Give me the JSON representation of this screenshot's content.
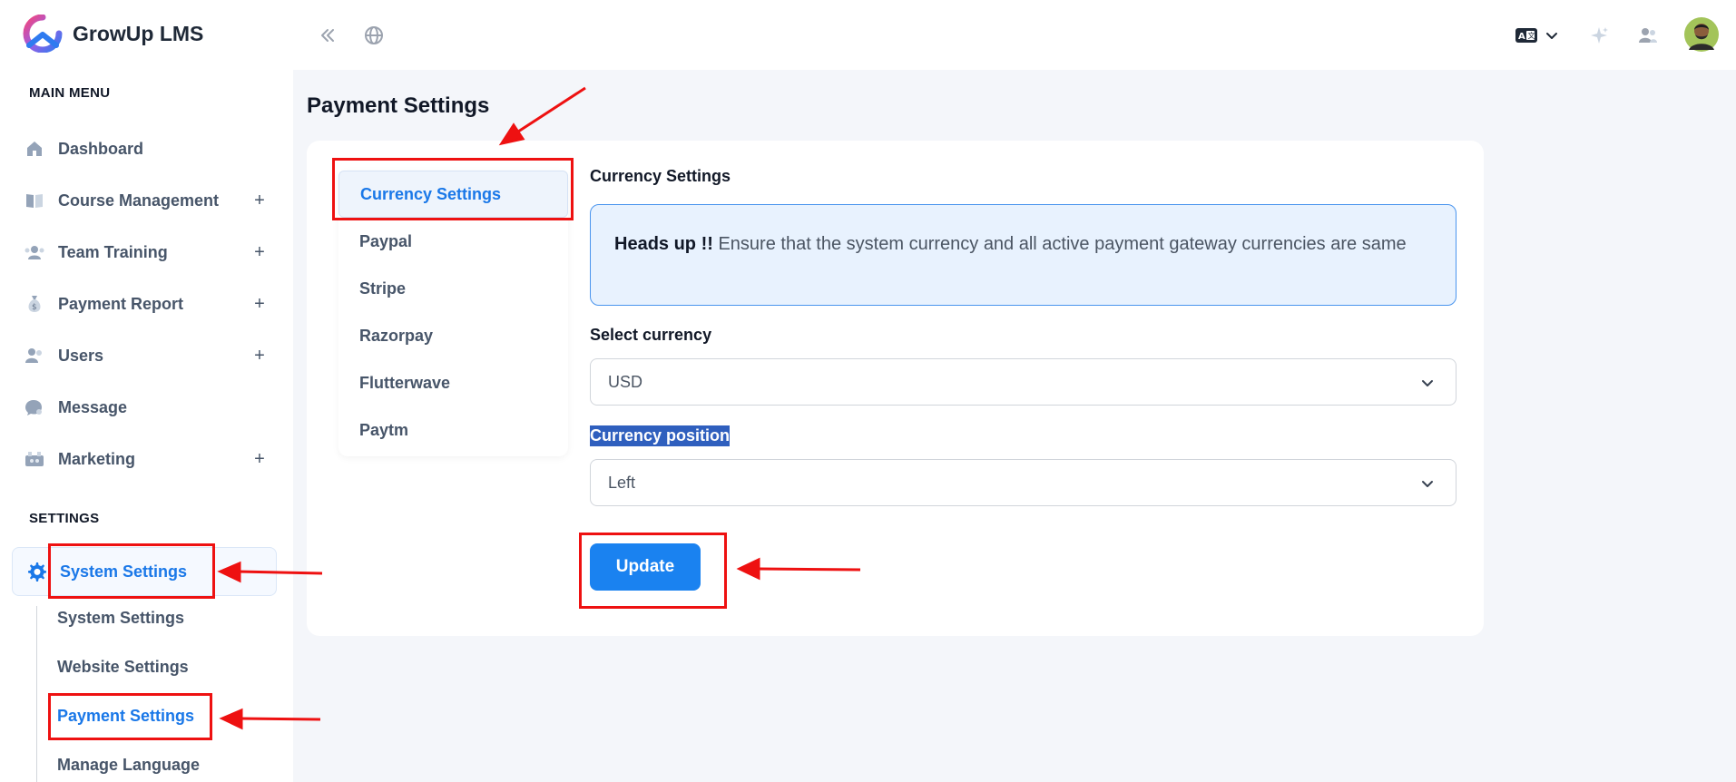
{
  "app": {
    "name": "GrowUp LMS"
  },
  "sidebar": {
    "main_menu_heading": "MAIN MENU",
    "items": [
      {
        "label": "Dashboard",
        "icon": "home-icon",
        "expandable": false
      },
      {
        "label": "Course Management",
        "icon": "book-icon",
        "expandable": true
      },
      {
        "label": "Team Training",
        "icon": "team-icon",
        "expandable": true
      },
      {
        "label": "Payment Report",
        "icon": "money-bag-icon",
        "expandable": true
      },
      {
        "label": "Users",
        "icon": "users-icon",
        "expandable": true
      },
      {
        "label": "Message",
        "icon": "chat-icon",
        "expandable": false
      },
      {
        "label": "Marketing",
        "icon": "megaphone-icon",
        "expandable": true
      }
    ],
    "settings_heading": "SETTINGS",
    "active_group": {
      "label": "System Settings",
      "icon": "gear-icon"
    },
    "sub_items": [
      {
        "label": "System Settings",
        "active": false
      },
      {
        "label": "Website Settings",
        "active": false
      },
      {
        "label": "Payment Settings",
        "active": true
      },
      {
        "label": "Manage Language",
        "active": false
      }
    ],
    "plus_symbol": "+"
  },
  "topbar": {
    "icons": [
      "collapse-icon",
      "globe-icon",
      "language-icon",
      "chevron-down-icon",
      "sparkle-icon",
      "users-icon",
      "avatar"
    ]
  },
  "page": {
    "title": "Payment Settings",
    "tabs": [
      "Currency Settings",
      "Paypal",
      "Stripe",
      "Razorpay",
      "Flutterwave",
      "Paytm"
    ],
    "active_tab": "Currency Settings",
    "section_title": "Currency Settings",
    "alert": {
      "strong": "Heads up !!",
      "text": "Ensure that the system currency and all active payment gateway currencies are same"
    },
    "currency_label": "Select currency",
    "currency_value": "USD",
    "position_label": "Currency position",
    "position_value": "Left",
    "update_label": "Update"
  },
  "colors": {
    "accent": "#1a82f0",
    "active_text": "#1a78e8",
    "annotation": "#ee1111",
    "alert_bg": "#e8f2fe"
  }
}
